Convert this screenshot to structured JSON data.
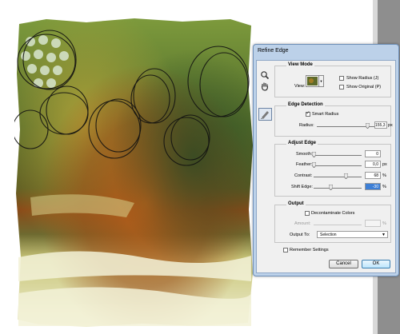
{
  "dialog": {
    "title": "Refine Edge",
    "icons": [
      "zoom-tool-icon",
      "hand-tool-icon",
      "refine-radius-brush-icon"
    ]
  },
  "view_mode": {
    "title": "View Mode",
    "view_label": "View:",
    "show_radius_label": "Show Radius (J)",
    "show_original_label": "Show Original (P)",
    "show_radius_checked": false,
    "show_original_checked": false
  },
  "edge_detection": {
    "title": "Edge Detection",
    "smart_radius_label": "Smart Radius",
    "smart_radius_checked": true,
    "radius_label": "Radius:",
    "radius_value": "155,3",
    "radius_unit": "px",
    "radius_slider_fraction": 0.88
  },
  "adjust_edge": {
    "title": "Adjust Edge",
    "smooth_label": "Smooth:",
    "smooth_value": "0",
    "smooth_fraction": 0.0,
    "feather_label": "Feather:",
    "feather_value": "0,0",
    "feather_unit": "px",
    "feather_fraction": 0.0,
    "contrast_label": "Contrast:",
    "contrast_value": "68",
    "contrast_unit": "%",
    "contrast_fraction": 0.68,
    "shift_label": "Shift Edge:",
    "shift_value": "-30",
    "shift_unit": "%",
    "shift_fraction": 0.35
  },
  "output": {
    "title": "Output",
    "decontaminate_label": "Decontaminate Colors",
    "decontaminate_checked": false,
    "amount_label": "Amount:",
    "amount_unit": "%",
    "output_to_label": "Output To:",
    "output_to_value": "Selection"
  },
  "remember_settings_label": "Remember Settings",
  "remember_settings_checked": false,
  "buttons": {
    "cancel": "Cancel",
    "ok": "OK"
  }
}
